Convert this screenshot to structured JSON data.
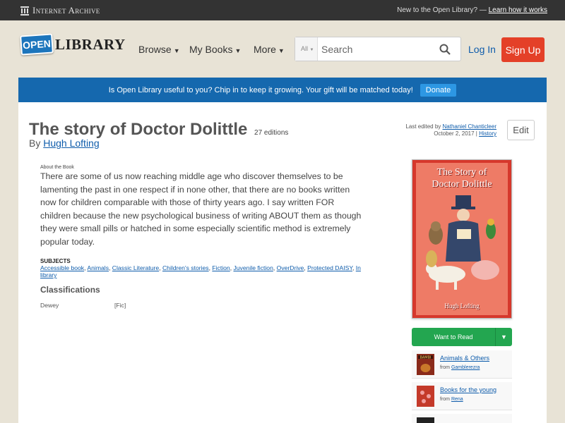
{
  "topbar": {
    "brand": "Internet Archive",
    "prompt": "New to the Open Library? —",
    "prompt_link": "Learn how it works"
  },
  "header": {
    "logo_open": "OPEN",
    "logo_library": "LIBRARY",
    "nav": [
      "Browse",
      "My Books",
      "More"
    ],
    "search_scope": "All",
    "search_placeholder": "Search",
    "login": "Log In",
    "signup": "Sign Up"
  },
  "banner": {
    "text": "Is Open Library useful to you? Chip in to keep it growing. Your gift will be matched today!",
    "button": "Donate"
  },
  "book": {
    "title": "The story of Doctor Dolittle",
    "editions": "27 editions",
    "by": "By",
    "author": "Hugh Lofting",
    "last_edited_prefix": "Last edited by",
    "last_edited_by": "Nathaniel Chanticleer",
    "last_edited_date": "October 2, 2017 |",
    "history": "History",
    "edit": "Edit",
    "about_label": "About the Book",
    "description": "There are some of us now reaching middle age who discover themselves to be lamenting the past in one respect if in none other, that there are no books written now for children comparable with those of thirty years ago. I say written FOR children because the new psychological business of writing ABOUT them as though they were small pills or hatched in some especially scientific method is extremely popular today.",
    "subjects_label": "SUBJECTS",
    "subjects": [
      "Accessible book",
      "Animals",
      "Classic Literature",
      "Children's stories",
      "Fiction",
      "Juvenile fiction",
      "OverDrive",
      "Protected DAISY",
      "In library"
    ],
    "classifications_label": "Classifications",
    "dewey_label": "Dewey",
    "dewey_value": "[Fic]"
  },
  "cover": {
    "title_line1": "The Story of",
    "title_line2": "Doctor Dolittle",
    "author": "Hugh Lofting"
  },
  "sidebar": {
    "want_to_read": "Want to Read",
    "lists": [
      {
        "title": "Animals & Others",
        "from": "from",
        "user": "Gamblerezra",
        "color": "#8a2a1a"
      },
      {
        "title": "Books for the young",
        "from": "from",
        "user": "Rena",
        "color": "#c43a2a"
      }
    ]
  },
  "colors": {
    "accent_blue": "#1568ae",
    "signup_red": "#e44028",
    "want_green": "#23a650"
  }
}
